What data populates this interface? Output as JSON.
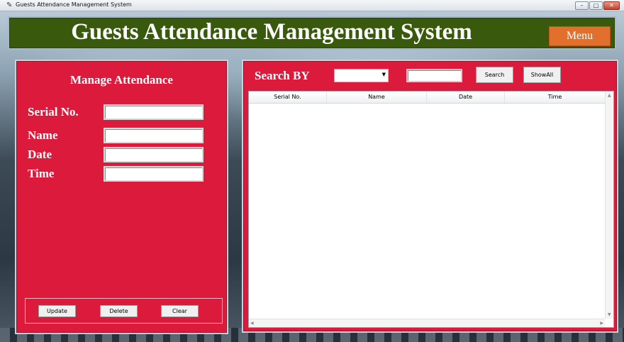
{
  "window": {
    "title": "Guests Attendance Management System",
    "minimize_glyph": "–",
    "maximize_glyph": "□",
    "close_glyph": "✕"
  },
  "header": {
    "title": "Guests Attendance Management System",
    "menu_label": "Menu",
    "bg_color": "#395a0d",
    "menu_color": "#e2702c"
  },
  "manage": {
    "heading": "Manage Attendance",
    "fields": [
      {
        "label": "Serial No.",
        "value": ""
      },
      {
        "label": "Name",
        "value": ""
      },
      {
        "label": "Date",
        "value": ""
      },
      {
        "label": "Time",
        "value": ""
      }
    ],
    "buttons": {
      "update": "Update",
      "delete": "Delete",
      "clear": "Clear"
    },
    "panel_color": "#db1a3c"
  },
  "search": {
    "label": "Search BY",
    "select_value": "",
    "input_value": "",
    "search_button": "Search",
    "showall_button": "ShowAll"
  },
  "table": {
    "columns": [
      "Serial No.",
      "Name",
      "Date",
      "Time"
    ],
    "rows": []
  }
}
